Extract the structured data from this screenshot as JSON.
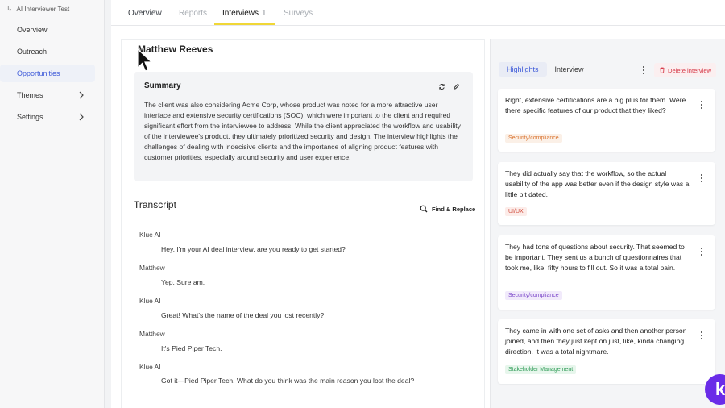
{
  "sidebar": {
    "app_title": "AI Interviewer Test",
    "items": [
      {
        "label": "Overview"
      },
      {
        "label": "Outreach"
      },
      {
        "label": "Opportunities"
      },
      {
        "label": "Themes"
      },
      {
        "label": "Settings"
      }
    ]
  },
  "tabs": {
    "items": [
      {
        "label": "Overview"
      },
      {
        "label": "Reports"
      },
      {
        "label": "Interviews"
      },
      {
        "label": "Surveys"
      }
    ],
    "interviews_count": "1"
  },
  "interview": {
    "name": "Matthew Reeves",
    "summary_title": "Summary",
    "summary_text": "The client was also considering Acme Corp, whose product was noted for a more attractive user interface and extensive security certifications (SOC), which were important to the client and required significant effort from the interviewee to address. While the client appreciated the workflow and usability of the interviewee's product, they ultimately prioritized security and design. The interview highlights the challenges of dealing with indecisive clients and the importance of aligning product features with customer priorities, especially around security and user experience.",
    "transcript_title": "Transcript",
    "find_replace": "Find & Replace",
    "transcript": [
      {
        "speaker": "Klue AI",
        "text": "Hey, I'm your AI deal interview, are you ready to get started?"
      },
      {
        "speaker": "Matthew",
        "text": "Yep. Sure am."
      },
      {
        "speaker": "Klue AI",
        "text": "Great! What's the name of the deal you lost recently?"
      },
      {
        "speaker": "Matthew",
        "text": "It's Pied Piper Tech."
      },
      {
        "speaker": "Klue AI",
        "text": "Got it—Pied Piper Tech. What do you think was the main reason you lost the deal?"
      }
    ]
  },
  "right_panel": {
    "seg_highlights": "Highlights",
    "seg_interview": "Interview",
    "delete_label": "Delete interview",
    "highlights": [
      {
        "text": "Right, extensive certifications are a big plus for them. Were there specific features of our product that they liked?",
        "tag": "Security/compliance"
      },
      {
        "text": "They did actually say that the workflow, so the actual usability of the app was better even if the design style was a little bit dated.",
        "tag": "UI/UX"
      },
      {
        "text": "They had tons of questions about security. That seemed to be important. They sent us a bunch of questionnaires that took me, like, fifty hours to fill out. So it was a total pain.",
        "tag": "Security/compliance"
      },
      {
        "text": "They came in with one set of asks and then another person joined, and then they just kept on just, like, kinda changing direction. It was a total nightmare.",
        "tag": "Stakeholder Management"
      }
    ]
  },
  "fab": {
    "label": "k"
  },
  "colors": {
    "accent_blue": "#3f5bd9",
    "tab_underline": "#f0d736",
    "delete_red": "#d73a49",
    "fab_purple": "#6a2ce8"
  },
  "icons": [
    "return-arrow-icon",
    "chevron-right-icon",
    "refresh-icon",
    "pencil-icon",
    "search-icon",
    "kebab-menu-icon",
    "trash-icon",
    "mouse-cursor"
  ]
}
